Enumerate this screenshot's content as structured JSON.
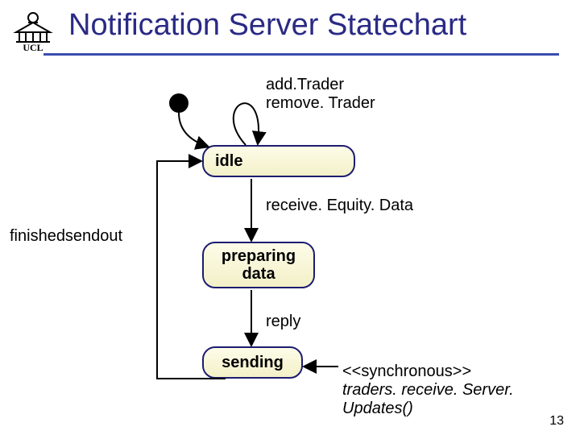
{
  "title": "Notification Server Statechart",
  "logo_text": "UCL",
  "states": {
    "idle": "idle",
    "preparing": "preparing data",
    "sending": "sending"
  },
  "labels": {
    "self_loop_1": "add.Trader",
    "self_loop_2": "remove. Trader",
    "receive": "receive. Equity. Data",
    "finished": "finishedsendout",
    "reply": "reply",
    "sync_1": "<<synchronous>>",
    "sync_2": "traders. receive. Server. Updates()"
  },
  "page_number": "13"
}
